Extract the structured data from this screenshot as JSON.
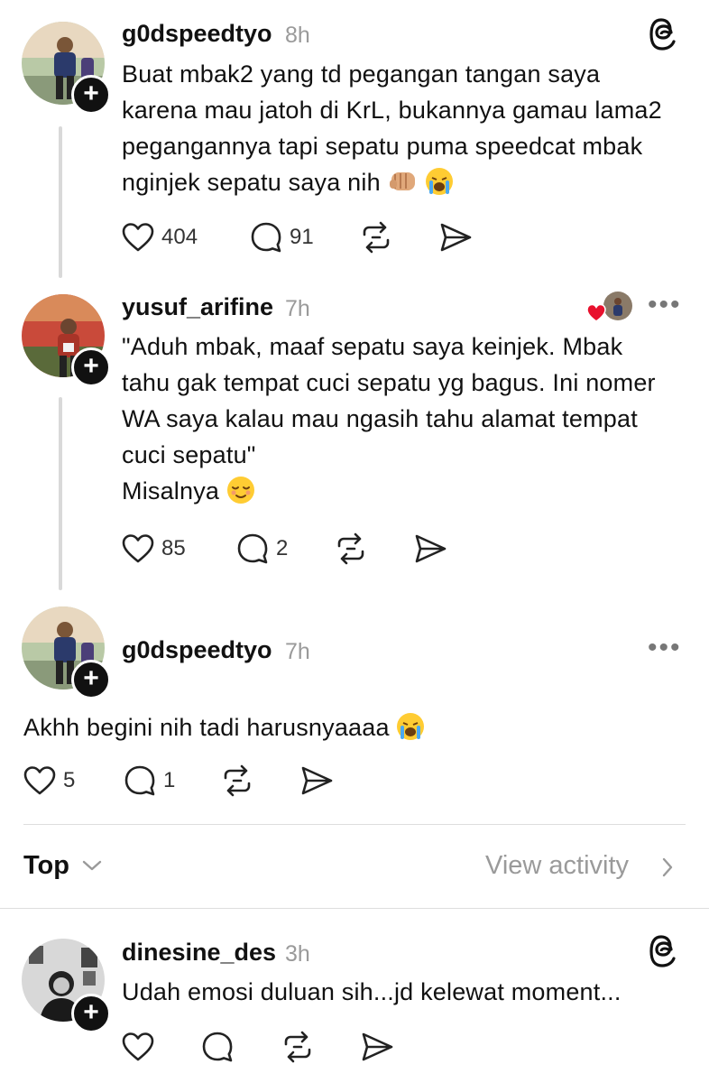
{
  "posts": [
    {
      "username": "g0dspeedtyo",
      "time": "8h",
      "text_lines": [
        "Buat mbak2 yang td pegangan tangan saya",
        "karena mau jatoh di KrL, bukannya gamau lama2",
        "pegangannya tapi sepatu puma speedcat mbak",
        "nginjek sepatu saya nih"
      ],
      "like_count": "404",
      "comment_count": "91"
    },
    {
      "username": "yusuf_arifine",
      "time": "7h",
      "text_lines": [
        "\"Aduh mbak, maaf sepatu saya keinjek. Mbak",
        "tahu gak tempat cuci sepatu yg bagus. Ini nomer",
        "WA saya kalau mau ngasih tahu alamat tempat",
        "cuci sepatu\""
      ],
      "text_line_5": "Misalnya",
      "like_count": "85",
      "comment_count": "2"
    },
    {
      "username": "g0dspeedtyo",
      "time": "7h",
      "text": "Akhh begini nih tadi harusnyaaaa",
      "like_count": "5",
      "comment_count": "1"
    }
  ],
  "sort": {
    "label": "Top",
    "view_activity": "View activity"
  },
  "reply": {
    "username": "dinesine_des",
    "time": "3h",
    "text": "Udah emosi duluan sih...jd kelewat moment..."
  },
  "icons": {
    "threads_logo": "threads-logo-icon",
    "like": "heart-icon",
    "comment": "comment-icon",
    "repost": "repost-icon",
    "share": "send-icon",
    "more": "more-dots-icon"
  },
  "colors": {
    "text": "#111111",
    "muted": "#9a9a9a",
    "like_red": "#e8112d"
  }
}
